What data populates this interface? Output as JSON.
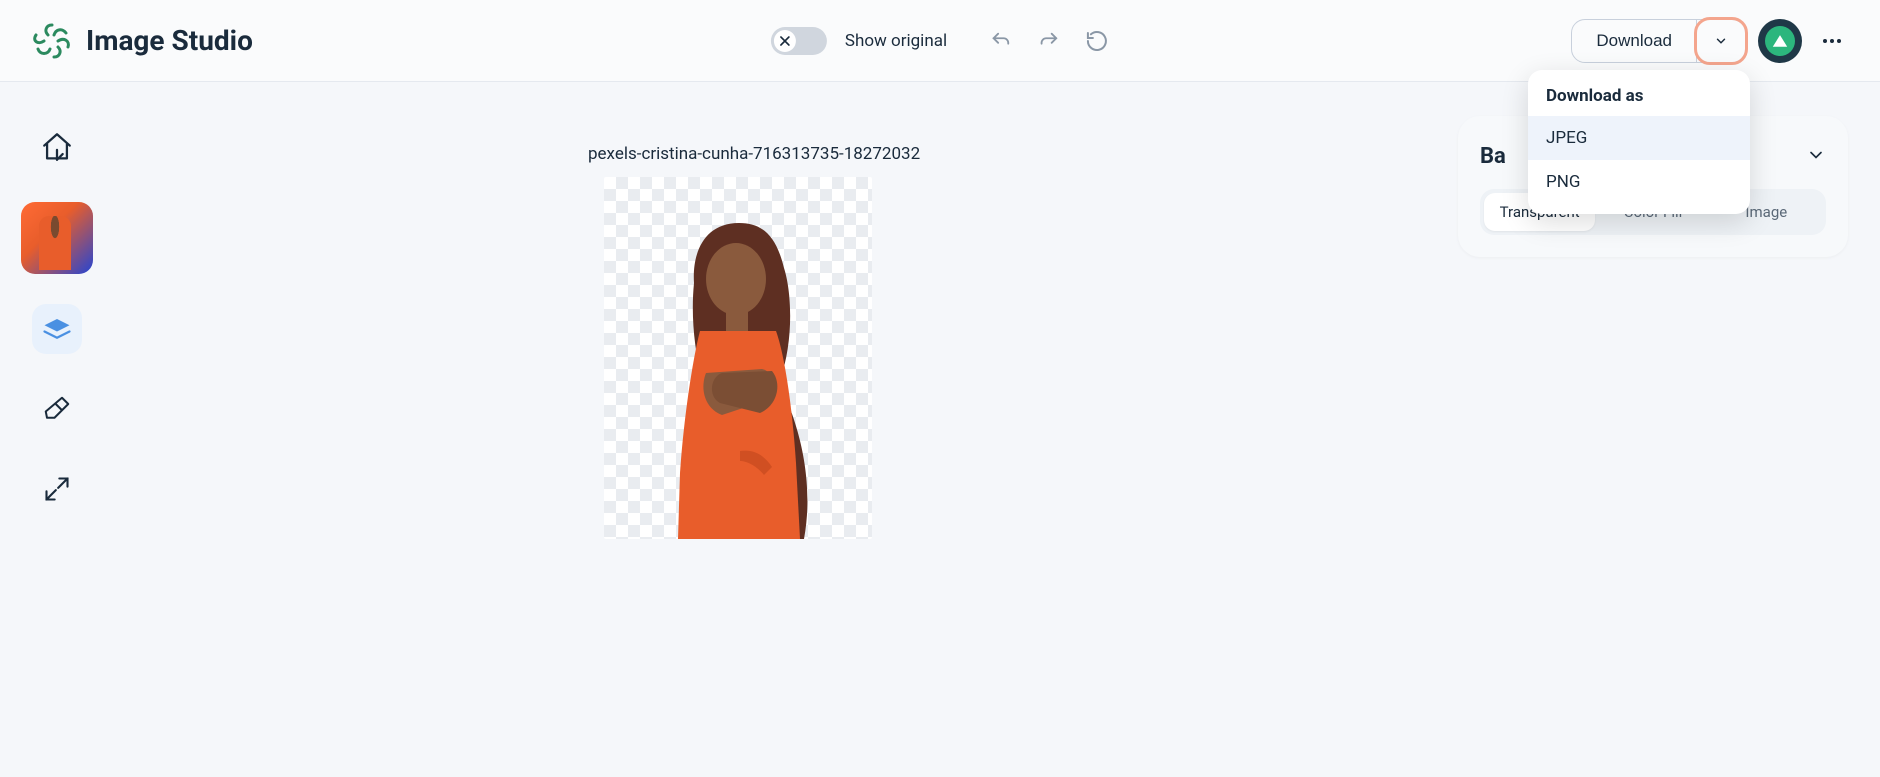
{
  "app": {
    "title": "Image Studio"
  },
  "header": {
    "show_original_label": "Show original",
    "download_label": "Download"
  },
  "download_menu": {
    "title": "Download as",
    "items": [
      "JPEG",
      "PNG"
    ],
    "highlighted": 0
  },
  "sidebar": {
    "tools": [
      "home",
      "thumbnail",
      "background",
      "eraser",
      "expand"
    ]
  },
  "canvas": {
    "filename": "pexels-cristina-cunha-716313735-18272032"
  },
  "right_panel": {
    "title_visible_fragment": "Ba",
    "tabs": [
      {
        "label": "Transparent",
        "active": true
      },
      {
        "label": "Color Fill",
        "active": false
      },
      {
        "label": "Image",
        "active": false
      }
    ]
  }
}
